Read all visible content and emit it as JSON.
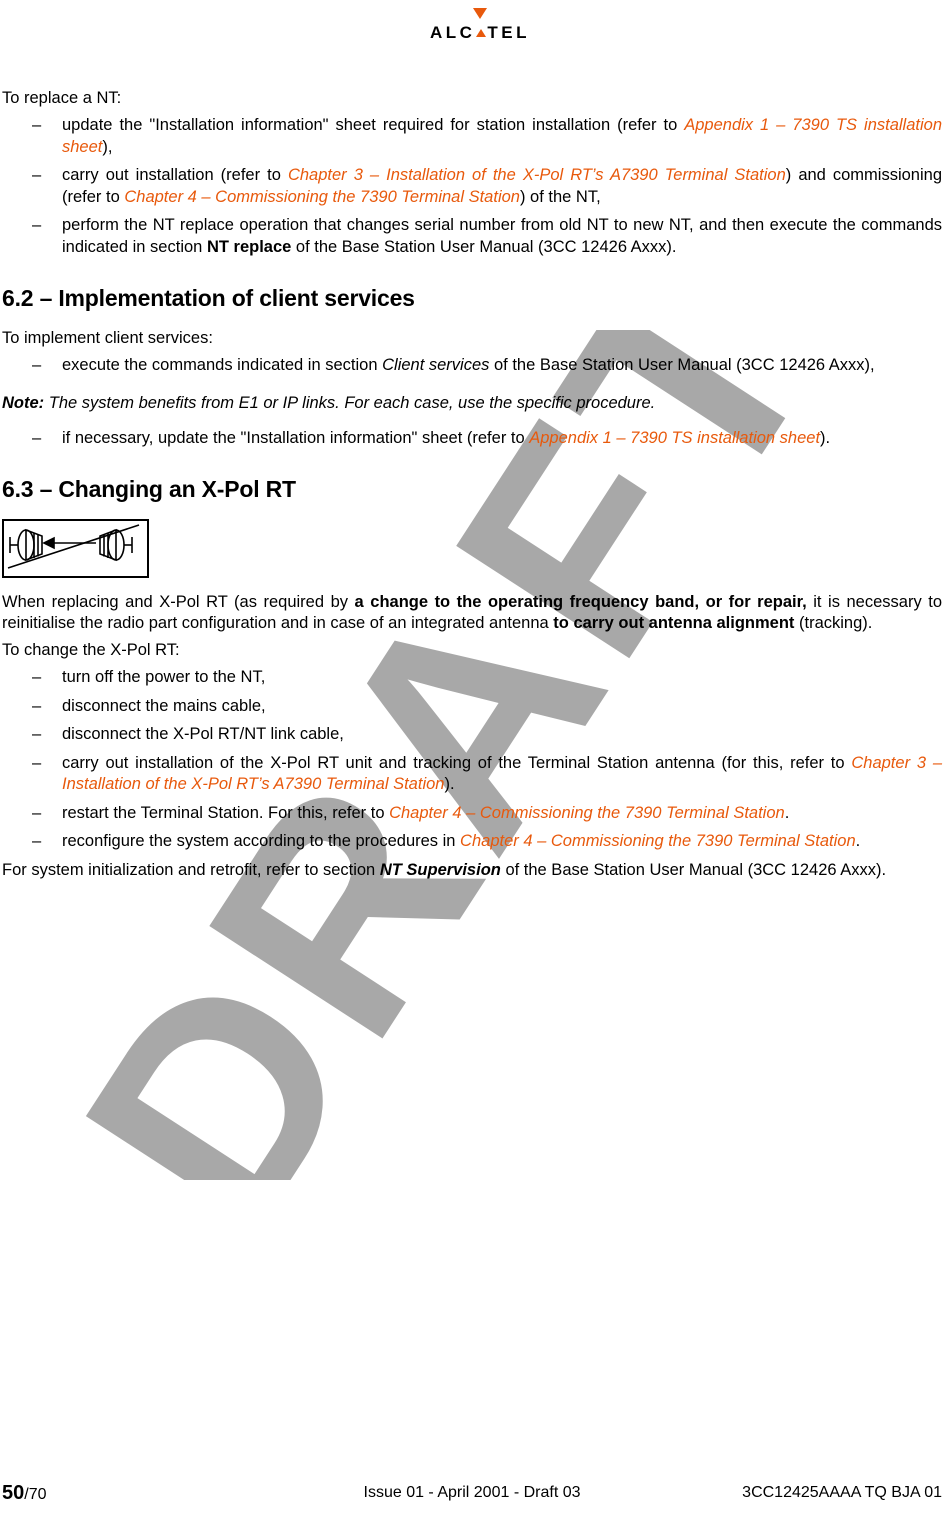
{
  "header": {
    "brand": "ALCATEL",
    "brand_letters": [
      "A",
      "L",
      "C",
      "A",
      "T",
      "E",
      "L"
    ],
    "arrow_icon": "down-arrow-icon"
  },
  "watermark": {
    "text": "DRAFT",
    "color": "#a6a6a6"
  },
  "intro": {
    "lead": "To replace a NT:",
    "items": [
      {
        "parts": [
          {
            "t": "update the \"Installation information\" sheet required for station installation (refer to ",
            "s": "plain"
          },
          {
            "t": "Appendix 1 – 7390 TS installation sheet",
            "s": "xref"
          },
          {
            "t": "),",
            "s": "plain"
          }
        ]
      },
      {
        "parts": [
          {
            "t": "carry out installation (refer to ",
            "s": "plain"
          },
          {
            "t": "Chapter 3 – Installation of the X-Pol RT’s A7390 Terminal  Station",
            "s": "xref"
          },
          {
            "t": ") and commissioning (refer to ",
            "s": "plain"
          },
          {
            "t": "Chapter 4 – Commissioning the 7390 Terminal Station",
            "s": "xref"
          },
          {
            "t": ") of the NT,",
            "s": "plain"
          }
        ]
      },
      {
        "parts": [
          {
            "t": "perform the NT replace operation that changes serial number from old NT to new NT, and then execute the commands indicated in section ",
            "s": "plain"
          },
          {
            "t": "NT replace",
            "s": "bold"
          },
          {
            "t": " of the Base Station User Manual (3CC 12426 Axxx).",
            "s": "plain"
          }
        ]
      }
    ]
  },
  "section_62": {
    "heading": "6.2 –  Implementation of client services",
    "lead": "To implement client services:",
    "items": [
      {
        "parts": [
          {
            "t": "execute the commands indicated in section ",
            "s": "plain"
          },
          {
            "t": "Client services",
            "s": "ital"
          },
          {
            "t": " of the Base Station User Manual (3CC 12426 Axxx),",
            "s": "plain"
          }
        ]
      }
    ],
    "note_label": "Note:",
    "note_text": " The system benefits from E1 or IP links. For each case, use the specific procedure.",
    "items2": [
      {
        "parts": [
          {
            "t": "if necessary, update the \"Installation information\" sheet (refer to ",
            "s": "plain"
          },
          {
            "t": "Appendix 1 – 7390 TS installation sheet",
            "s": "xref"
          },
          {
            "t": ").",
            "s": "plain"
          }
        ]
      }
    ]
  },
  "section_63": {
    "heading": "6.3 –  Changing an X-Pol RT",
    "figure_name": "antenna-swap-figure",
    "paragraph1": [
      {
        "t": "When replacing and X-Pol RT (as required by ",
        "s": "plain"
      },
      {
        "t": "a change to the operating frequency band, or for repair,",
        "s": "bold"
      },
      {
        "t": " it is necessary to reinitialise the radio part configuration and in case of an integrated antenna ",
        "s": "plain"
      },
      {
        "t": "to carry out antenna alignment",
        "s": "bold"
      },
      {
        "t": " (tracking).",
        "s": "plain"
      }
    ],
    "lead": "To change the X-Pol RT:",
    "items": [
      {
        "parts": [
          {
            "t": "turn off the power to the NT,",
            "s": "plain"
          }
        ]
      },
      {
        "parts": [
          {
            "t": "disconnect the mains cable,",
            "s": "plain"
          }
        ]
      },
      {
        "parts": [
          {
            "t": "disconnect the X-Pol RT/NT link cable,",
            "s": "plain"
          }
        ]
      },
      {
        "parts": [
          {
            "t": "carry out installation of the X-Pol RT unit and tracking of the Terminal Station antenna (for this, refer to ",
            "s": "plain"
          },
          {
            "t": "Chapter 3 – Installation of the X-Pol RT’s A7390 Terminal  Station",
            "s": "xref"
          },
          {
            "t": ").",
            "s": "plain"
          }
        ]
      },
      {
        "parts": [
          {
            "t": "restart the Terminal Station. For this, refer to ",
            "s": "plain"
          },
          {
            "t": "Chapter 4 – Commissioning the 7390 Terminal Station",
            "s": "xref"
          },
          {
            "t": ".",
            "s": "plain"
          }
        ]
      },
      {
        "parts": [
          {
            "t": "reconfigure the system according to the procedures in ",
            "s": "plain"
          },
          {
            "t": "Chapter 4 – Commissioning the 7390 Terminal Station",
            "s": "xref"
          },
          {
            "t": ".",
            "s": "plain"
          }
        ]
      }
    ],
    "closing": [
      {
        "t": "For system initialization and retrofit, refer to section ",
        "s": "plain"
      },
      {
        "t": "NT Supervision",
        "s": "bolditalic"
      },
      {
        "t": " of the Base Station User Manual (3CC 12426 Axxx).",
        "s": "plain"
      }
    ]
  },
  "footer": {
    "page_number": "50",
    "page_total": "/70",
    "center": "Issue 01 - April 2001 - Draft 03",
    "right": "3CC12425AAAA TQ BJA 01"
  }
}
